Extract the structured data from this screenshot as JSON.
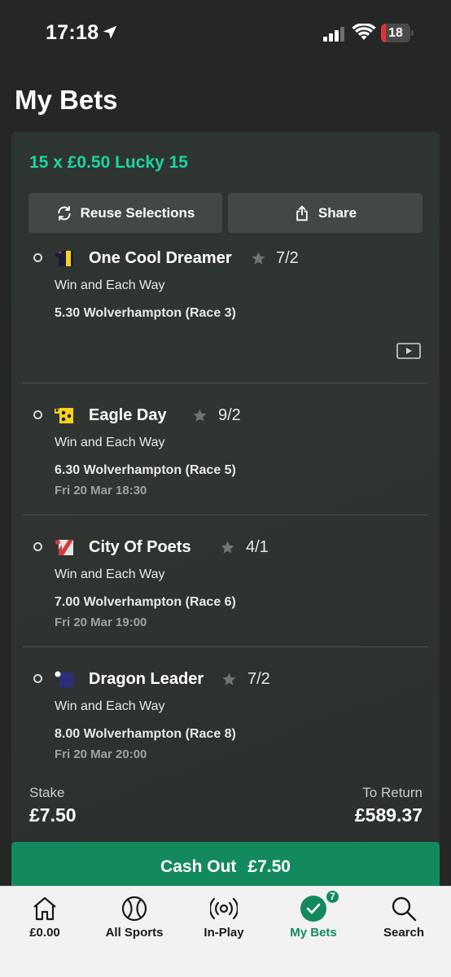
{
  "status_bar": {
    "time": "17:18",
    "battery": "18",
    "battery_color": "#e5312f"
  },
  "page_title": "My Bets",
  "bet": {
    "title": "15 x £0.50 Lucky 15",
    "reuse_label": "Reuse Selections",
    "share_label": "Share",
    "selections": [
      {
        "name": "One Cool Dreamer",
        "odds": "7/2",
        "market": "Win and Each Way",
        "race": "5.30 Wolverhampton (Race 3)",
        "date": "",
        "silk": "navy-yellow-stripe",
        "video_icon": "play-video-icon"
      },
      {
        "name": "Eagle Day",
        "odds": "9/2",
        "market": "Win and Each Way",
        "race": "6.30 Wolverhampton (Race 5)",
        "date": "Fri 20 Mar 18:30",
        "silk": "yellow-black-spots"
      },
      {
        "name": "City Of Poets",
        "odds": "4/1",
        "market": "Win and Each Way",
        "race": "7.00 Wolverhampton (Race 6)",
        "date": "Fri 20 Mar 19:00",
        "silk": "red-white-diagonal"
      },
      {
        "name": "Dragon Leader",
        "odds": "7/2",
        "market": "Win and Each Way",
        "race": "8.00 Wolverhampton (Race 8)",
        "date": "Fri 20 Mar 20:00",
        "silk": "navy-white-cap"
      }
    ],
    "stake_label": "Stake",
    "stake_value": "£7.50",
    "return_label": "To Return",
    "return_value": "£589.37",
    "cashout_label": "Cash Out",
    "cashout_value": "£7.50"
  },
  "nav": {
    "items": [
      {
        "label": "£0.00",
        "icon": "home-icon"
      },
      {
        "label": "All Sports",
        "icon": "tennis-ball-icon"
      },
      {
        "label": "In-Play",
        "icon": "broadcast-icon"
      },
      {
        "label": "My Bets",
        "icon": "check-circle-icon",
        "badge": "7",
        "active": true
      },
      {
        "label": "Search",
        "icon": "search-icon"
      }
    ]
  },
  "colors": {
    "accent_green": "#138a5e",
    "title_green": "#19d6a0",
    "background": "#252726"
  }
}
